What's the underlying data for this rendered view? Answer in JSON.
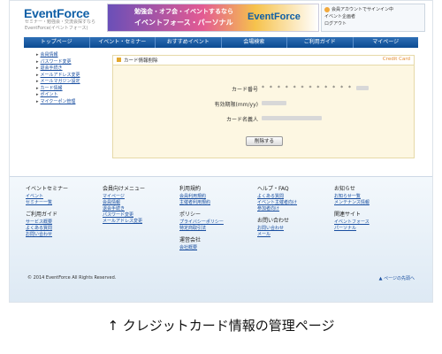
{
  "header": {
    "logo": "EventForce",
    "logo_sub": "セミナー・勉強会・交流会探すならEventForce(イベントフォース)",
    "banner_line1": "勉強会・オフ会・イベントするなら",
    "banner_line2": "イベントフォース・パーソナル",
    "banner_brand": "EventForce",
    "user_line1": "会員アカウントでサインイン中",
    "user_line2": "イベント企画者",
    "user_line3": "ログアウト"
  },
  "nav": [
    "トップページ",
    "イベント・セミナー",
    "おすすめイベント",
    "会場検索",
    "ご利用ガイド",
    "マイページ"
  ],
  "left_menu": [
    "会員情報",
    "パスワード変更",
    "退会手続き",
    "メールアドレス変更",
    "メールマガジン設定",
    "カード情報",
    "ポイント",
    "マイクーポン管理"
  ],
  "panel": {
    "title": "カード情報削除",
    "tag": "Credit Card",
    "fields": [
      {
        "label": "カード番号",
        "value": "* * * * * * * * * * * *"
      },
      {
        "label": "有効期限(mm/yy)",
        "value": ""
      },
      {
        "label": "カード名義人",
        "value": ""
      }
    ],
    "delete_button": "削除する"
  },
  "footer": {
    "columns": [
      {
        "sections": [
          {
            "head": "イベントセミナー",
            "links": [
              "イベント",
              "セミナー一覧"
            ]
          },
          {
            "head": "ご利用ガイド",
            "links": [
              "サービス概要",
              "よくある質問",
              "お問い合わせ"
            ]
          }
        ]
      },
      {
        "sections": [
          {
            "head": "会員向けメニュー",
            "links": [
              "マイページ",
              "会員情報",
              "退会手続き",
              "パスワード変更",
              "メールアドレス変更"
            ]
          }
        ]
      },
      {
        "sections": [
          {
            "head": "利用規約",
            "links": [
              "会員利用規約",
              "主催者利用規約"
            ]
          },
          {
            "head": "ポリシー",
            "links": [
              "プライバシーポリシー",
              "特定商取引法"
            ]
          },
          {
            "head": "運営会社",
            "links": [
              "会社概要"
            ]
          }
        ]
      },
      {
        "sections": [
          {
            "head": "ヘルプ・FAQ",
            "links": [
              "よくある質問",
              "イベント主催者向け",
              "参加者向け"
            ]
          },
          {
            "head": "お問い合わせ",
            "links": [
              "お問い合わせ",
              "メール"
            ]
          }
        ]
      },
      {
        "sections": [
          {
            "head": "お知らせ",
            "links": [
              "お知らせ一覧",
              "メンテナンス情報"
            ]
          },
          {
            "head": "関連サイト",
            "links": [
              "イベントフォース",
              "パーソナル"
            ]
          }
        ]
      }
    ],
    "copyright": "© 2014 EventForce All Rights Reserved.",
    "pagetop": "ページの先頭へ"
  },
  "caption": "↑ クレジットカード情報の管理ページ"
}
